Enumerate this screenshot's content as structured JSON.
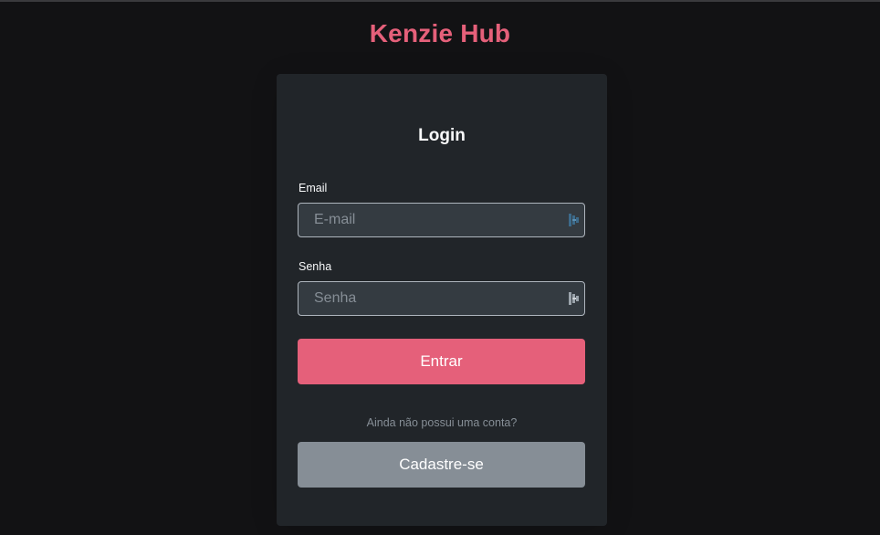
{
  "header": {
    "brand": "Kenzie Hub"
  },
  "login_form": {
    "title": "Login",
    "email": {
      "label": "Email",
      "placeholder": "E-mail",
      "value": ""
    },
    "password": {
      "label": "Senha",
      "placeholder": "Senha",
      "value": ""
    },
    "submit_label": "Entrar",
    "signup_hint": "Ainda não possui uma conta?",
    "signup_label": "Cadastre-se"
  },
  "icons": {
    "email_field_icon": "password-manager-icon",
    "password_field_icon": "password-manager-icon"
  },
  "colors": {
    "background": "#121214",
    "brand": "#e5607a",
    "card": "#212529",
    "input_bg": "#343b41",
    "input_border": "#aeb5bd",
    "primary_button": "#e5607a",
    "secondary_button": "#868e96",
    "muted_text": "#868e96",
    "text": "#f8f9fa"
  }
}
